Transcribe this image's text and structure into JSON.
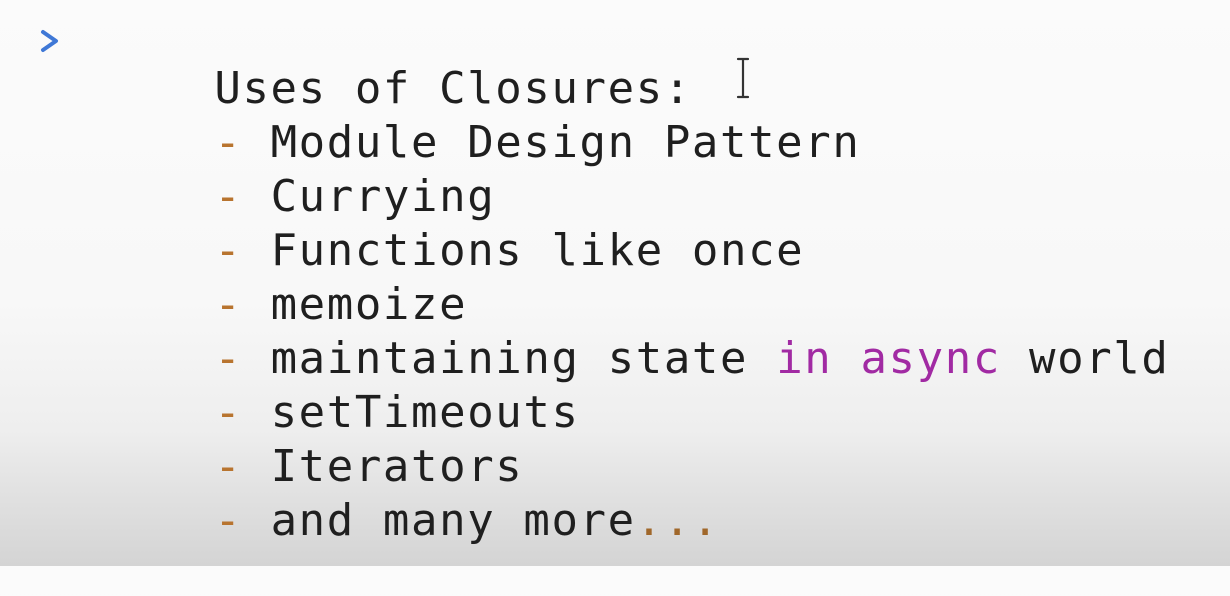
{
  "console": {
    "prompt_icon": "chevron-right-icon",
    "heading": "Uses of Closures:",
    "dash": "- ",
    "items": [
      "Module Design Pattern",
      "Currying",
      "Functions like once",
      "memoize"
    ],
    "item5": {
      "before": "maintaining state ",
      "keyword_in": "in",
      "space": " ",
      "keyword_async": "async",
      "after": " world"
    },
    "item6": "setTimeouts",
    "item7": "Iterators",
    "item8": {
      "text": "and many more",
      "ellipsis": "..."
    },
    "cursor_icon": "text-cursor-icon",
    "colors": {
      "prompt": "#3f78d6",
      "text": "#1f1f1f",
      "dash": "#b8742f",
      "keyword": "#a12aa3",
      "ellipsis": "#a0672a"
    }
  }
}
